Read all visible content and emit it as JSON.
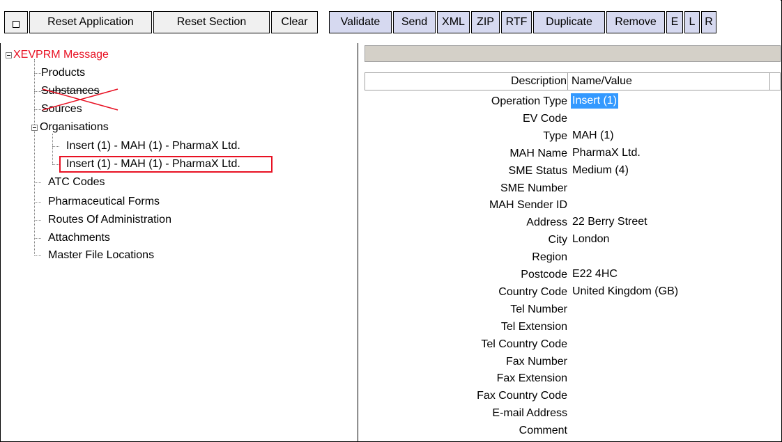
{
  "toolbar": {
    "toggle": "",
    "buttons_plain": [
      "Reset Application",
      "Reset Section",
      "Clear"
    ],
    "buttons_blue": [
      "Validate",
      "Send",
      "XML",
      "ZIP",
      "RTF",
      "Duplicate",
      "Remove",
      "E",
      "L",
      "R"
    ]
  },
  "tree": {
    "root": "XEVPRM Message",
    "products": "Products",
    "substances": "Substances",
    "sources": "Sources",
    "organisations": "Organisations",
    "org_item_1": "Insert (1) - MAH (1) - PharmaX Ltd.",
    "org_item_2": "Insert (1) - MAH (1) - PharmaX Ltd.",
    "atc": "ATC Codes",
    "pharm_forms": "Pharmaceutical Forms",
    "routes": "Routes Of Administration",
    "attachments": "Attachments",
    "master_file": "Master File Locations"
  },
  "grid": {
    "header_description": "Description",
    "header_value": "Name/Value",
    "rows": [
      {
        "label": "Operation Type",
        "value": "Insert (1)"
      },
      {
        "label": "EV Code",
        "value": ""
      },
      {
        "label": "Type",
        "value": "MAH (1)"
      },
      {
        "label": "MAH Name",
        "value": "PharmaX Ltd."
      },
      {
        "label": "SME Status",
        "value": "Medium (4)"
      },
      {
        "label": "SME Number",
        "value": ""
      },
      {
        "label": "MAH Sender ID",
        "value": ""
      },
      {
        "label": "Address",
        "value": "22 Berry Street"
      },
      {
        "label": "City",
        "value": "London"
      },
      {
        "label": "Region",
        "value": ""
      },
      {
        "label": "Postcode",
        "value": "E22 4HC"
      },
      {
        "label": "Country Code",
        "value": "United Kingdom (GB)"
      },
      {
        "label": "Tel Number",
        "value": ""
      },
      {
        "label": "Tel Extension",
        "value": ""
      },
      {
        "label": "Tel Country Code",
        "value": ""
      },
      {
        "label": "Fax Number",
        "value": ""
      },
      {
        "label": "Fax Extension",
        "value": ""
      },
      {
        "label": "Fax Country Code",
        "value": ""
      },
      {
        "label": "E-mail Address",
        "value": ""
      },
      {
        "label": "Comment",
        "value": ""
      }
    ]
  },
  "colors": {
    "root_label": "#e81123",
    "highlight_box": "#e81123",
    "selection": "#3399ff",
    "blue_button": "#d6d9f0",
    "strike": "#e81123"
  }
}
